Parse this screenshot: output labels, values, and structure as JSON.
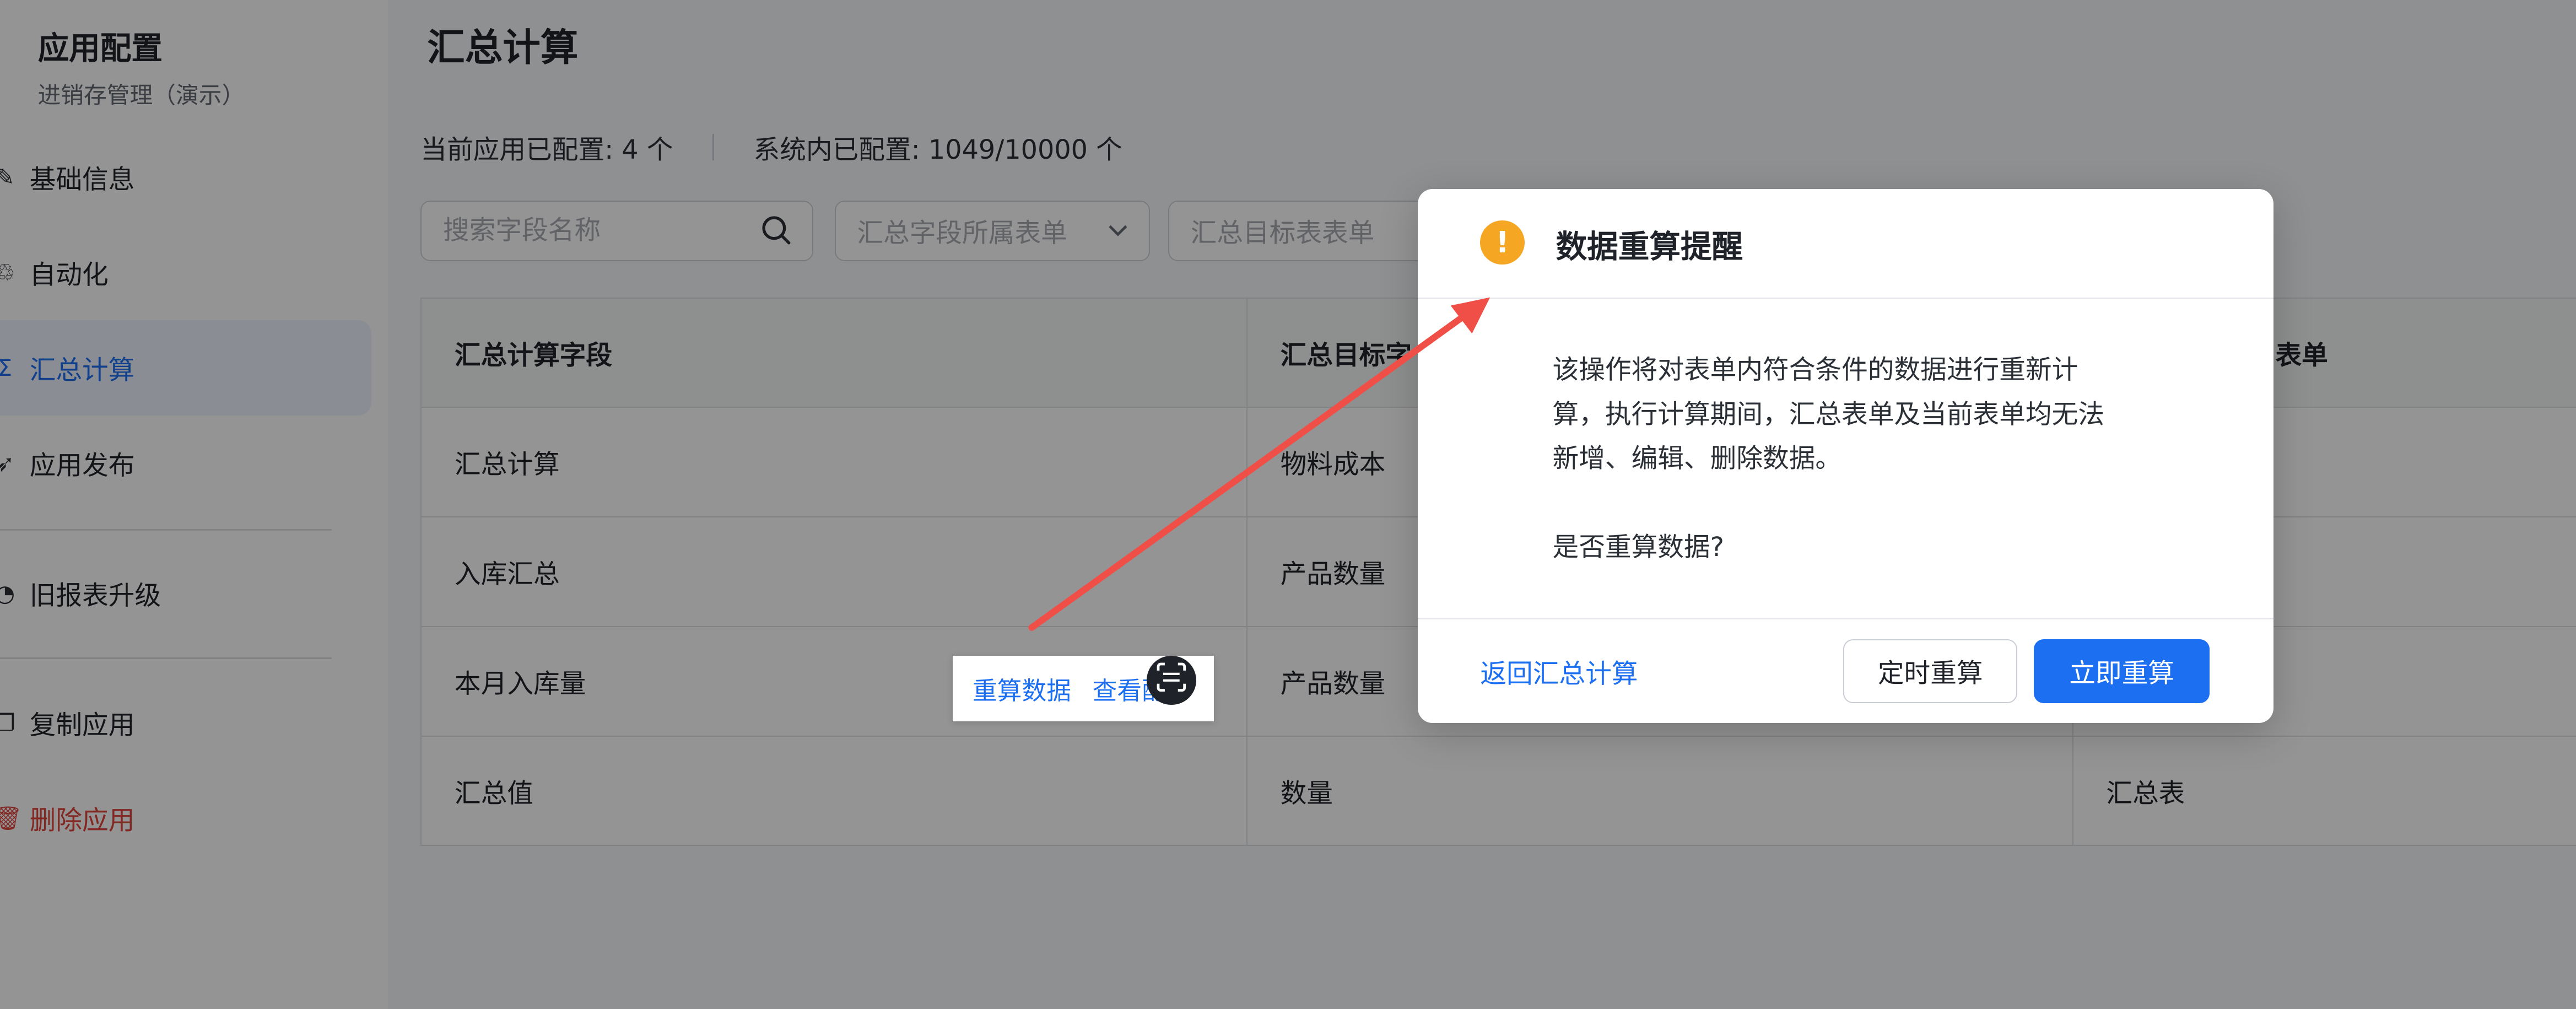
{
  "sidebar": {
    "app_title": "应用配置",
    "app_subtitle": "进销存管理（演示）",
    "items": [
      {
        "label": "基础信息",
        "icon": "edit-icon"
      },
      {
        "label": "自动化",
        "icon": "automation-icon"
      },
      {
        "label": "汇总计算",
        "icon": "sigma-icon",
        "active": true
      },
      {
        "label": "应用发布",
        "icon": "rocket-icon"
      },
      {
        "label": "旧报表升级",
        "icon": "chart-icon"
      },
      {
        "label": "复制应用",
        "icon": "copy-icon"
      },
      {
        "label": "删除应用",
        "icon": "trash-icon"
      }
    ]
  },
  "main": {
    "title": "汇总计算",
    "stats": {
      "current": "当前应用已配置: 4 个",
      "system": "系统内已配置: 1049/10000 个"
    },
    "search_placeholder": "搜索字段名称",
    "filter_form_placeholder": "汇总字段所属表单",
    "filter_target_placeholder": "汇总目标表表单",
    "table": {
      "headers": [
        "汇总计算字段",
        "汇总目标字",
        "表单"
      ],
      "rows": [
        [
          "汇总计算",
          "物料成本",
          ""
        ],
        [
          "入库汇总",
          "产品数量",
          ""
        ],
        [
          "本月入库量",
          "产品数量",
          ""
        ],
        [
          "汇总值",
          "数量",
          "汇总表"
        ]
      ]
    },
    "row_actions": {
      "recalc": "重算数据",
      "view": "查看配"
    }
  },
  "dialog": {
    "title": "数据重算提醒",
    "body_lines": [
      "该操作将对表单内符合条件的数据进行重新计",
      "算，执行计算期间，汇总表单及当前表单均无法",
      "新增、编辑、删除数据。"
    ],
    "question": "是否重算数据?",
    "back_link": "返回汇总计算",
    "schedule_button": "定时重算",
    "now_button": "立即重算"
  },
  "colors": {
    "accent": "#1d6ff2",
    "warning": "#f5a623",
    "danger": "#e0443c",
    "annotation_arrow": "#ef4f47"
  }
}
